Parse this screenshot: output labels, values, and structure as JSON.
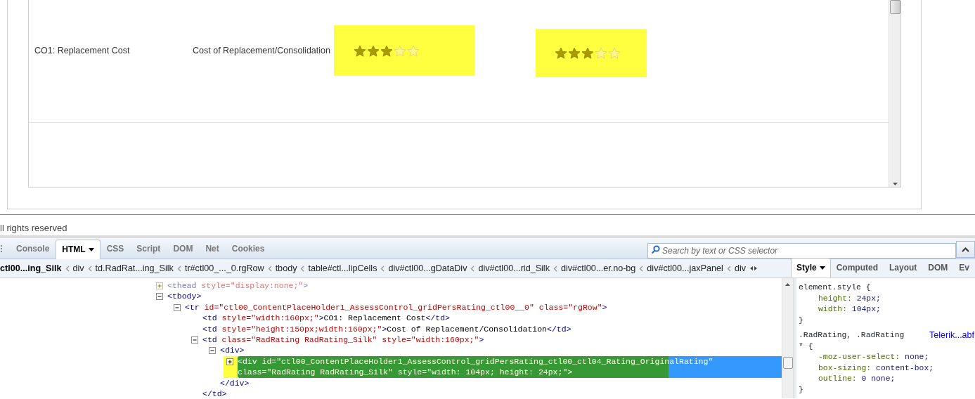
{
  "grid": {
    "rows": [
      {
        "cells": [
          "CO1: Replacement Cost",
          "Cost of Replacement/Consolidation"
        ],
        "ratings": [
          {
            "stars": 3,
            "highlighted": true
          },
          {
            "stars": 3,
            "highlighted": true
          }
        ]
      }
    ]
  },
  "footer": {
    "text": "ll rights reserved"
  },
  "firebug": {
    "tabs": [
      {
        "label": "Console",
        "selected": false,
        "dropdown": false
      },
      {
        "label": "HTML",
        "selected": true,
        "dropdown": true
      },
      {
        "label": "CSS",
        "selected": false,
        "dropdown": false
      },
      {
        "label": "Script",
        "selected": false,
        "dropdown": false
      },
      {
        "label": "DOM",
        "selected": false,
        "dropdown": false
      },
      {
        "label": "Net",
        "selected": false,
        "dropdown": false
      },
      {
        "label": "Cookies",
        "selected": false,
        "dropdown": false
      }
    ],
    "search": {
      "placeholder": "Search by text or CSS selector"
    },
    "breadcrumbs": [
      {
        "label": "ctl00...ing_Silk",
        "selected": true
      },
      {
        "label": "div",
        "selected": false
      },
      {
        "label": "td.RadRat...ing_Silk",
        "selected": false
      },
      {
        "label": "tr#ctl00_..._0.rgRow",
        "selected": false
      },
      {
        "label": "tbody",
        "selected": false
      },
      {
        "label": "table#ctl...lipCells",
        "selected": false
      },
      {
        "label": "div#ctl00...gDataDiv",
        "selected": false
      },
      {
        "label": "div#ctl00...rid_Silk",
        "selected": false
      },
      {
        "label": "div#ctl00...er.no-bg",
        "selected": false
      },
      {
        "label": "div#ctl00...jaxPanel",
        "selected": false
      },
      {
        "label": "div",
        "selected": false
      }
    ],
    "side_tabs": [
      {
        "label": "Style",
        "selected": true,
        "dropdown": true
      },
      {
        "label": "Computed",
        "selected": false,
        "dropdown": false
      },
      {
        "label": "Layout",
        "selected": false,
        "dropdown": false
      },
      {
        "label": "DOM",
        "selected": false,
        "dropdown": false
      },
      {
        "label": "Ev",
        "selected": false,
        "dropdown": false
      }
    ],
    "html_tree": [
      {
        "expanded": false,
        "dimmed": true,
        "selected": false,
        "tokens": [
          {
            "kind": "tag",
            "text": "<thead"
          },
          {
            "kind": "attr",
            "text": " style="
          },
          {
            "kind": "value",
            "text": "\"display:none;\""
          },
          {
            "kind": "tag",
            "text": ">"
          }
        ]
      },
      {
        "expanded": true,
        "dimmed": false,
        "selected": false,
        "tokens": [
          {
            "kind": "tag",
            "text": "<tbody>"
          }
        ],
        "children": [
          {
            "expanded": true,
            "dimmed": false,
            "selected": false,
            "tokens": [
              {
                "kind": "tag",
                "text": "<tr"
              },
              {
                "kind": "attr",
                "text": " id="
              },
              {
                "kind": "value",
                "text": "\"ctl00_ContentPlaceHolder1_AssessControl_gridPersRating_ctl00__0\""
              },
              {
                "kind": "attr",
                "text": " class="
              },
              {
                "kind": "value",
                "text": "\"rgRow\""
              },
              {
                "kind": "tag",
                "text": ">"
              }
            ],
            "children": [
              {
                "dimmed": false,
                "selected": false,
                "tokens": [
                  {
                    "kind": "tag",
                    "text": "<td"
                  },
                  {
                    "kind": "attr",
                    "text": " style="
                  },
                  {
                    "kind": "value",
                    "text": "\"width:160px;\""
                  },
                  {
                    "kind": "tag",
                    "text": ">"
                  },
                  {
                    "kind": "text",
                    "text": "CO1: Replacement Cost"
                  },
                  {
                    "kind": "tag",
                    "text": "</td>"
                  }
                ]
              },
              {
                "dimmed": false,
                "selected": false,
                "tokens": [
                  {
                    "kind": "tag",
                    "text": "<td"
                  },
                  {
                    "kind": "attr",
                    "text": " style="
                  },
                  {
                    "kind": "value",
                    "text": "\"height:150px;width:160px;\""
                  },
                  {
                    "kind": "tag",
                    "text": ">"
                  },
                  {
                    "kind": "text",
                    "text": "Cost of Replacement/Consolidation"
                  },
                  {
                    "kind": "tag",
                    "text": "</td>"
                  }
                ]
              },
              {
                "expanded": true,
                "dimmed": false,
                "selected": false,
                "tokens": [
                  {
                    "kind": "tag",
                    "text": "<td"
                  },
                  {
                    "kind": "attr",
                    "text": " class="
                  },
                  {
                    "kind": "value",
                    "text": "\"RadRating RadRating_Silk\""
                  },
                  {
                    "kind": "attr",
                    "text": " style="
                  },
                  {
                    "kind": "value",
                    "text": "\"width:160px;\""
                  },
                  {
                    "kind": "tag",
                    "text": ">"
                  }
                ],
                "closing": "</td>",
                "children": [
                  {
                    "expanded": true,
                    "dimmed": false,
                    "selected": false,
                    "tokens": [
                      {
                        "kind": "tag",
                        "text": "<div>"
                      }
                    ],
                    "closing": "</div>",
                    "children": [
                      {
                        "expanded": false,
                        "dimmed": false,
                        "selected": true,
                        "tokens": [
                          {
                            "kind": "tag",
                            "text": "<div"
                          },
                          {
                            "kind": "attr",
                            "text": " id="
                          },
                          {
                            "kind": "value",
                            "text": "\"ctl00_ContentPlaceHolder1_AssessControl_gridPersRating_ctl00_ctl04_Rating_OriginalRating\""
                          },
                          {
                            "kind": "attr",
                            "text": " class="
                          },
                          {
                            "kind": "value",
                            "text": "\"RadRating RadRating_Silk\""
                          },
                          {
                            "kind": "attr",
                            "text": " style="
                          },
                          {
                            "kind": "value",
                            "text": "\"width: 104px; height: 24px;\""
                          },
                          {
                            "kind": "tag",
                            "text": ">"
                          }
                        ]
                      }
                    ]
                  }
                ]
              }
            ]
          }
        ]
      }
    ],
    "css_rules": [
      {
        "selector": [
          "element.style {"
        ],
        "declarations": [
          {
            "property": "height:",
            "value": "24px;"
          },
          {
            "property": "width:",
            "value": "104px;"
          }
        ],
        "closing": "}"
      },
      {
        "selector": [
          ".RadRating, .RadRating",
          "* {"
        ],
        "source": "Telerik...abf",
        "declarations": [
          {
            "property": "-moz-user-select:",
            "value": "none;"
          },
          {
            "property": "box-sizing:",
            "value": "content-box;"
          },
          {
            "property": "outline:",
            "value": "0 none;"
          }
        ],
        "closing": "}"
      }
    ]
  }
}
